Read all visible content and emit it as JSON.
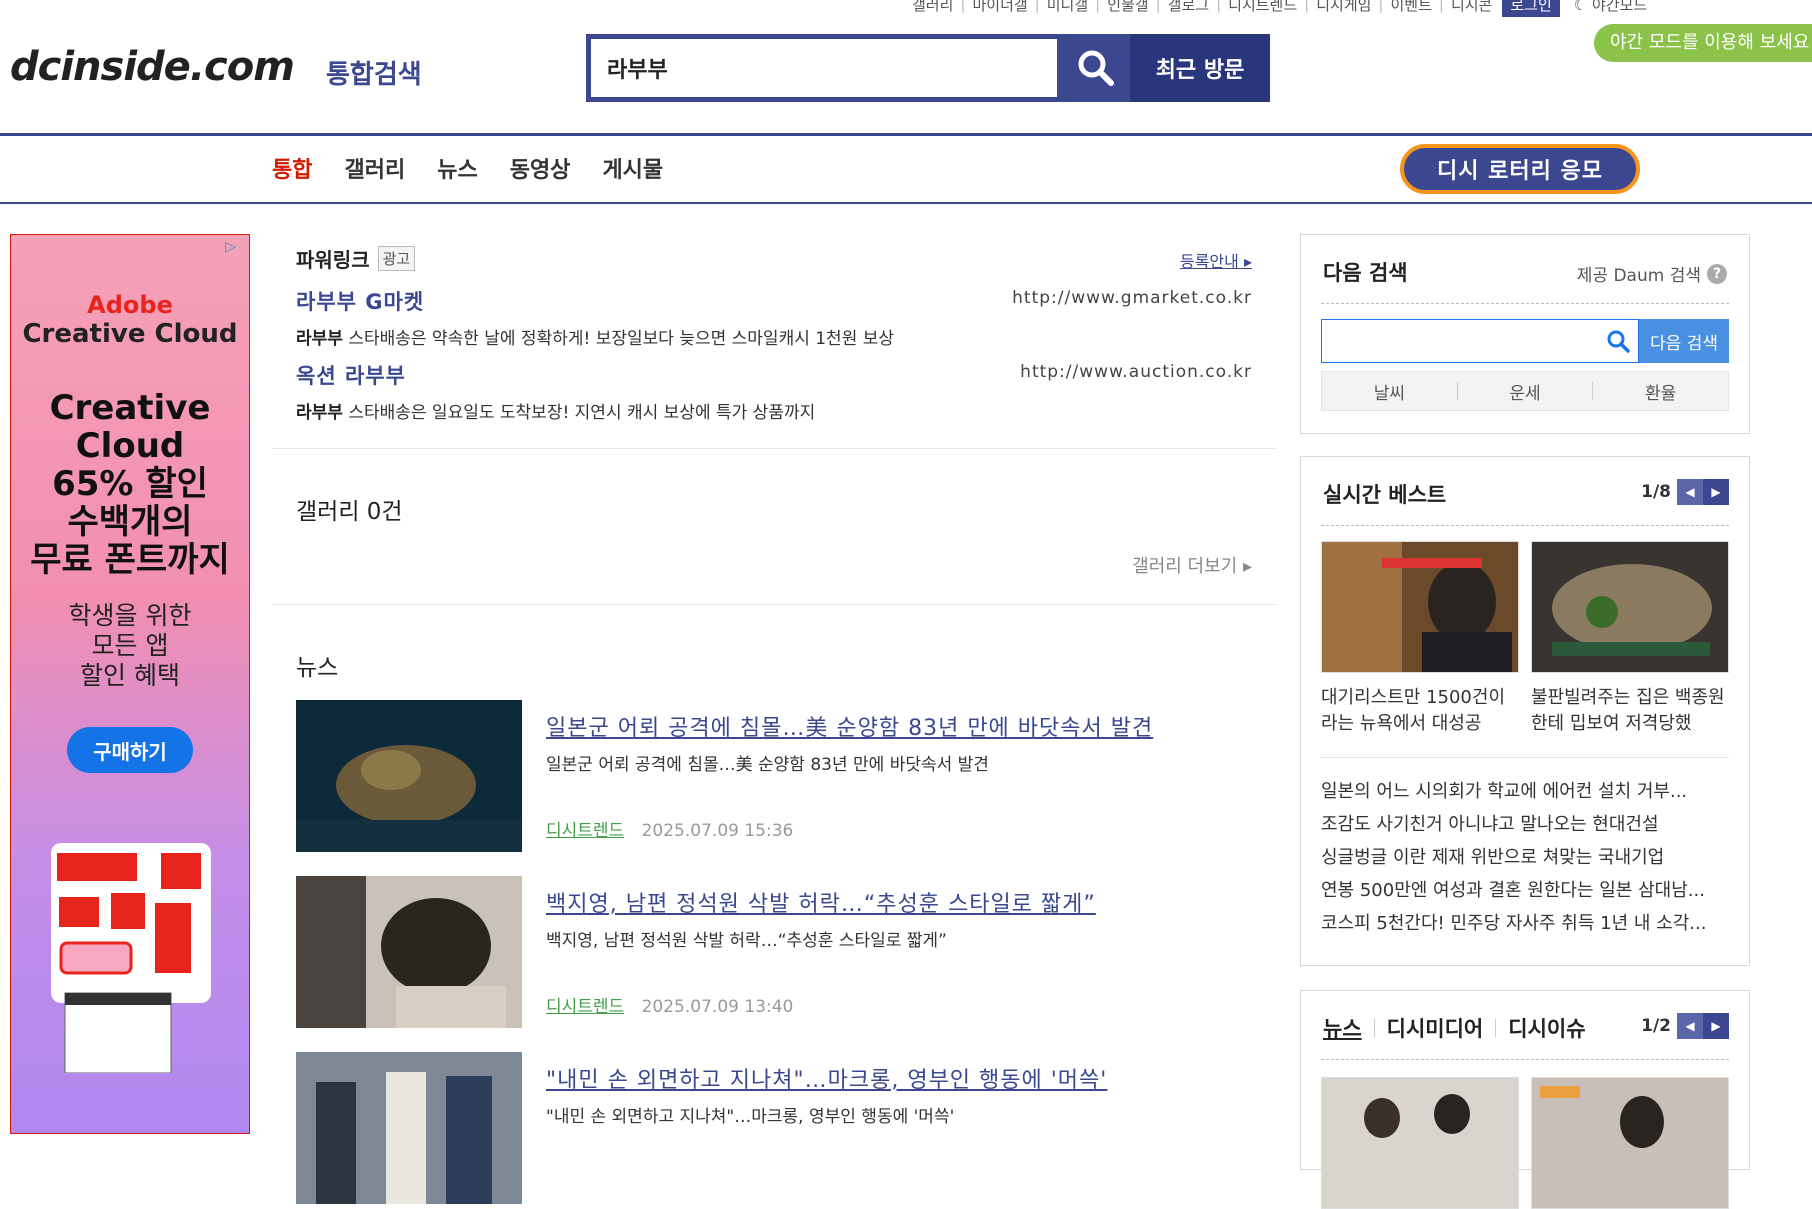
{
  "top_links": {
    "items": [
      "갤러리",
      "마이너갤",
      "미니갤",
      "인물갤",
      "갤로그",
      "디시트렌드",
      "디시게임",
      "이벤트",
      "디시콘"
    ],
    "login": "로그인",
    "night": "야간모드"
  },
  "tooltip": "야간 모드를 이용해 보세요",
  "header": {
    "logo": "dcinside.com",
    "logo_sub": "통합검색",
    "search_value": "라부부",
    "recent": "최근 방문"
  },
  "nav": {
    "tabs": [
      "통합",
      "갤러리",
      "뉴스",
      "동영상",
      "게시물"
    ],
    "lottery": "디시 로터리 응모"
  },
  "ad": {
    "brand1": "Adobe",
    "brand2": "Creative Cloud",
    "headline": [
      "Creative",
      "Cloud",
      "65% 할인",
      "수백개의",
      "무료 폰트까지"
    ],
    "sub": [
      "학생을 위한",
      "모든 앱",
      "할인 혜택"
    ],
    "buy": "구매하기"
  },
  "powerlink": {
    "title": "파워링크",
    "badge": "광고",
    "register": "등록안내",
    "items": [
      {
        "title": "라부부 G마켓",
        "url": "http://www.gmarket.co.kr",
        "keyword": "라부부",
        "desc": " 스타배송은 약속한 날에 정확하게! 보장일보다 늦으면 스마일캐시 1천원 보상"
      },
      {
        "title": "옥션 라부부",
        "url": "http://www.auction.co.kr",
        "keyword": "라부부",
        "desc": " 스타배송은 일요일도 도착보장! 지연시 캐시 보상에 특가 상품까지"
      }
    ]
  },
  "gallery": {
    "title": "갤러리 0건",
    "more": "갤러리 더보기"
  },
  "news": {
    "title": "뉴스",
    "items": [
      {
        "headline": "일본군 어뢰 공격에 침몰…美 순양함 83년 만에 바닷속서 발견",
        "desc": "일본군 어뢰 공격에 침몰…美 순양함 83년 만에 바닷속서 발견",
        "source": "디시트렌드",
        "date": "2025.07.09 15:36"
      },
      {
        "headline": "백지영, 남편 정석원 삭발 허락…“추성훈 스타일로 짧게”",
        "desc": "백지영, 남편 정석원 삭발 허락…“추성훈 스타일로 짧게”",
        "source": "디시트렌드",
        "date": "2025.07.09 13:40"
      },
      {
        "headline": "\"내민 손 외면하고 지나쳐\"…마크롱, 영부인 행동에 '머쓱'",
        "desc": "\"내민 손 외면하고 지나쳐\"…마크롱, 영부인 행동에 '머쓱'",
        "source": "",
        "date": ""
      }
    ]
  },
  "daum": {
    "title": "다음 검색",
    "provider": "제공 Daum 검색",
    "button": "다음 검색",
    "links": [
      "날씨",
      "운세",
      "환율"
    ]
  },
  "best": {
    "title": "실시간 베스트",
    "page": "1/8",
    "cards": [
      {
        "caption": "대기리스트만 1500건이라는 뉴욕에서 대성공"
      },
      {
        "caption": "불판빌려주는 집은 백종원한테 밉보여 저격당했"
      }
    ],
    "list": [
      "일본의 어느 시의회가 학교에 에어컨 설치 거부...",
      "조감도 사기친거 아니냐고 말나오는 현대건설",
      "싱글벙글 이란 제재 위반으로 쳐맞는 국내기업",
      "연봉 500만엔 여성과 결혼 원한다는 일본 삼대남...",
      "코스피 5천간다! 민주당 자사주 취득 1년 내 소각..."
    ]
  },
  "media": {
    "tabs": [
      "뉴스",
      "디시미디어",
      "디시이슈"
    ],
    "page": "1/2"
  },
  "colors": {
    "brand": "#3b4890",
    "active_tab": "#d31900",
    "lottery_border": "#f7941d",
    "news_source": "#43a047",
    "tooltip": "#8bc34a"
  }
}
